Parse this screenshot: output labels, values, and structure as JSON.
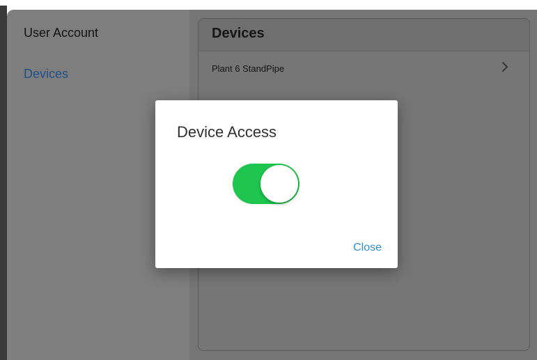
{
  "sidebar": {
    "items": [
      {
        "label": "User Account"
      },
      {
        "label": "Devices",
        "selected": true
      }
    ]
  },
  "main": {
    "panel_title": "Devices",
    "devices": [
      {
        "label": "Plant 6 StandPipe",
        "icon": "chevron-right-icon"
      }
    ]
  },
  "dialog": {
    "title": "Device Access",
    "toggle": {
      "checked": true,
      "color": "#1ec64f"
    },
    "close_label": "Close"
  },
  "colors": {
    "accent_link": "#2d8fdd",
    "selected_nav": "#1f4f86"
  }
}
